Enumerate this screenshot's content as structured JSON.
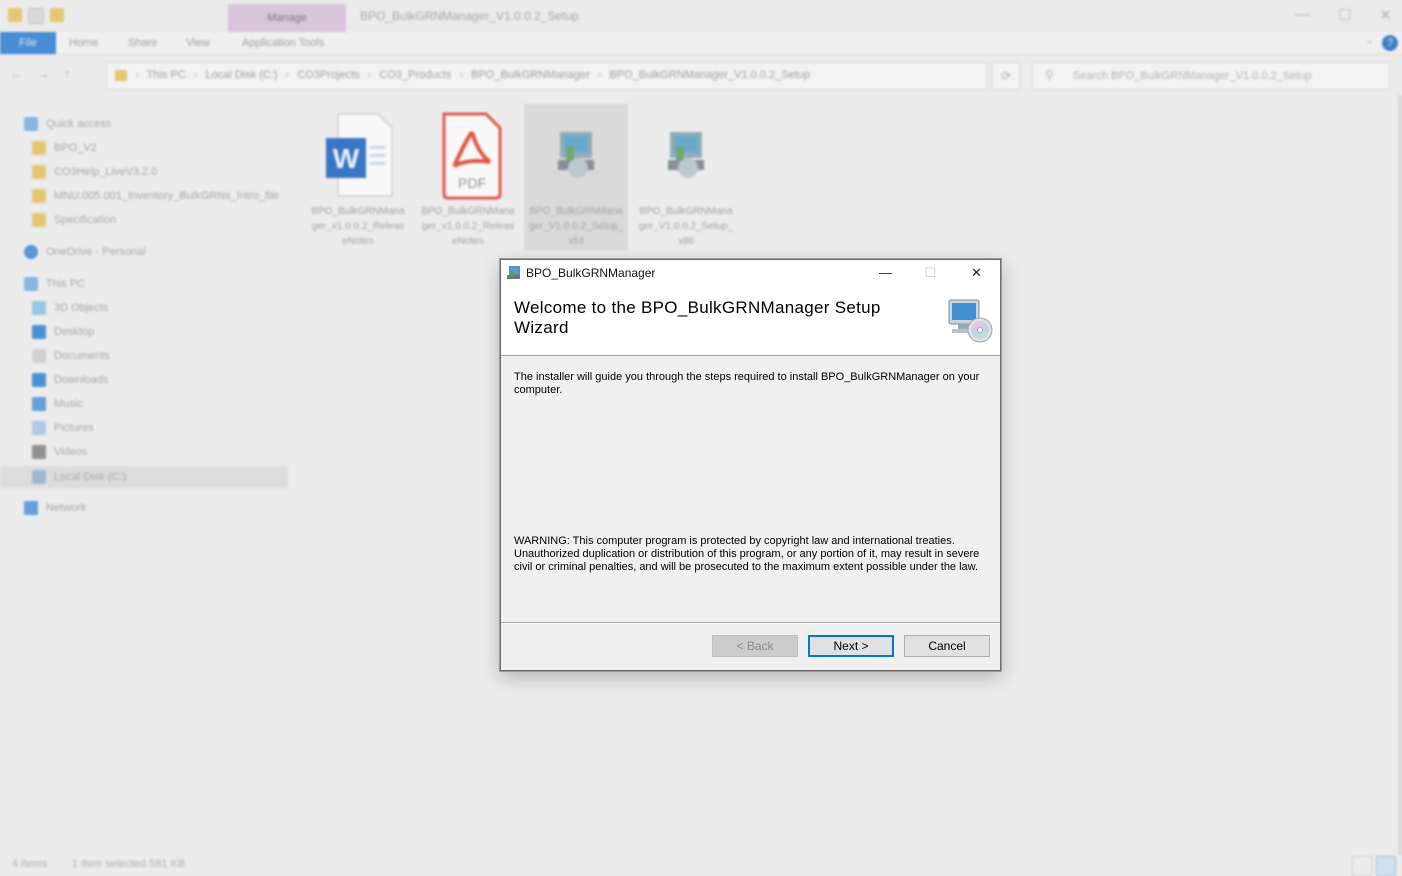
{
  "explorer": {
    "window_title": "BPO_BulkGRNManager_V1.0.0.2_Setup",
    "ribbon": {
      "manage_tab": "Manage",
      "file_tab": "File",
      "tabs": [
        "Home",
        "Share",
        "View",
        "Application Tools"
      ]
    },
    "breadcrumbs": [
      "This PC",
      "Local Disk (C:)",
      "CO3Projects",
      "CO3_Products",
      "BPO_BulkGRNManager",
      "BPO_BulkGRNManager_V1.0.0.2_Setup"
    ],
    "search_placeholder": "Search BPO_BulkGRNManager_V1.0.0.2_Setup",
    "sidebar": {
      "quick_access": "Quick access",
      "quick_items": [
        "BPO_V2",
        "CO3Help_LiveV3.2.0",
        "MNU.005.001_Inventory_BulkGRNs_Intro_file",
        "Specification"
      ],
      "onedrive": "OneDrive - Personal",
      "this_pc": "This PC",
      "pc_items": [
        "3D Objects",
        "Desktop",
        "Documents",
        "Downloads",
        "Music",
        "Pictures",
        "Videos",
        "Local Disk (C:)"
      ],
      "network": "Network"
    },
    "files": [
      {
        "name": "BPO_BulkGRNManager_v1.0.0.2_ReleaseNotes",
        "icon": "word-doc-icon"
      },
      {
        "name": "BPO_BulkGRNManager_v1.0.0.2_ReleaseNotes",
        "icon": "pdf-icon",
        "badge": "PDF"
      },
      {
        "name": "BPO_BulkGRNManager_V1.0.0.2_Setup_x64",
        "icon": "msi-installer-icon"
      },
      {
        "name": "BPO_BulkGRNManager_V1.0.0.2_Setup_x86",
        "icon": "msi-installer-icon"
      }
    ],
    "status": {
      "items": "4 items",
      "selection": "1 item selected  581 KB"
    }
  },
  "dialog": {
    "title": "BPO_BulkGRNManager",
    "heading": "Welcome to the BPO_BulkGRNManager Setup Wizard",
    "intro": "The installer will guide you through the steps required to install BPO_BulkGRNManager on your computer.",
    "warning": "WARNING: This computer program is protected by copyright law and international treaties. Unauthorized duplication or distribution of this program, or any portion of it, may result in severe civil or criminal penalties, and will be prosecuted to the maximum extent possible under the law.",
    "buttons": {
      "back": "< Back",
      "next": "Next >",
      "cancel": "Cancel"
    },
    "controls": {
      "minimize": "—",
      "maximize": "☐",
      "close": "✕"
    }
  },
  "colors": {
    "accent": "#0078d7",
    "file_tab": "#3b86d4",
    "manage_tab": "#d8c3d9"
  }
}
